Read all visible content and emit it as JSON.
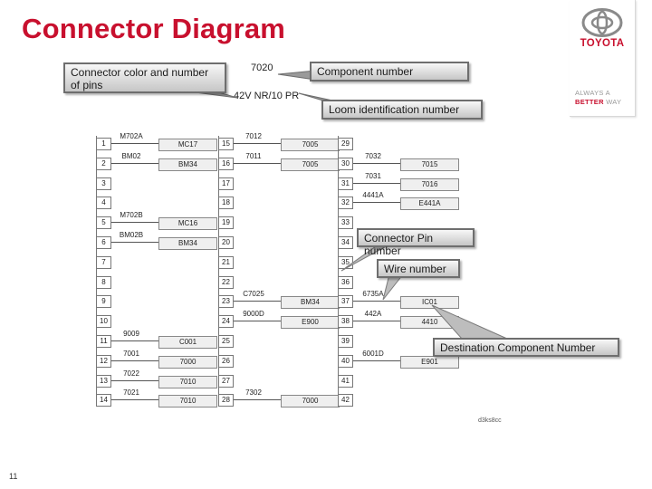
{
  "title": "Connector Diagram",
  "brand": {
    "name": "TOYOTA",
    "tagline_line1": "ALWAYS A",
    "tagline_better": "BETTER",
    "tagline_way": " WAY",
    "color": "#c8102e"
  },
  "connector": {
    "component_number": "7020",
    "loom_id": "42V NR/10 PR"
  },
  "callouts": {
    "connector_color": "Connector color and number of pins",
    "component_number": "Component number",
    "loom_identification": "Loom identification number",
    "connector_pin": "Connector Pin number",
    "wire_number": "Wire number",
    "destination_component": "Destination Component Number"
  },
  "columns": [
    {
      "pins": [
        {
          "pin": "1",
          "wire": "M702A",
          "dest": "MC17"
        },
        {
          "pin": "2",
          "wire": "BM02",
          "dest": "BM34"
        },
        {
          "pin": "3",
          "wire": "",
          "dest": ""
        },
        {
          "pin": "4",
          "wire": "",
          "dest": ""
        },
        {
          "pin": "5",
          "wire": "M702B",
          "dest": "MC16"
        },
        {
          "pin": "6",
          "wire": "BM02B",
          "dest": "BM34"
        },
        {
          "pin": "7",
          "wire": "",
          "dest": ""
        },
        {
          "pin": "8",
          "wire": "",
          "dest": ""
        },
        {
          "pin": "9",
          "wire": "",
          "dest": ""
        },
        {
          "pin": "10",
          "wire": "",
          "dest": ""
        },
        {
          "pin": "11",
          "wire": "9009",
          "dest": "C001"
        },
        {
          "pin": "12",
          "wire": "7001",
          "dest": "7000"
        },
        {
          "pin": "13",
          "wire": "7022",
          "dest": "7010"
        },
        {
          "pin": "14",
          "wire": "7021",
          "dest": "7010"
        }
      ]
    },
    {
      "pins": [
        {
          "pin": "15",
          "wire": "7012",
          "dest": "7005"
        },
        {
          "pin": "16",
          "wire": "7011",
          "dest": "7005"
        },
        {
          "pin": "17",
          "wire": "",
          "dest": ""
        },
        {
          "pin": "18",
          "wire": "",
          "dest": ""
        },
        {
          "pin": "19",
          "wire": "",
          "dest": ""
        },
        {
          "pin": "20",
          "wire": "",
          "dest": ""
        },
        {
          "pin": "21",
          "wire": "",
          "dest": ""
        },
        {
          "pin": "22",
          "wire": "",
          "dest": ""
        },
        {
          "pin": "23",
          "wire": "C7025",
          "dest": "BM34"
        },
        {
          "pin": "24",
          "wire": "9000D",
          "dest": "E900"
        },
        {
          "pin": "25",
          "wire": "",
          "dest": ""
        },
        {
          "pin": "26",
          "wire": "",
          "dest": ""
        },
        {
          "pin": "27",
          "wire": "",
          "dest": ""
        },
        {
          "pin": "28",
          "wire": "7302",
          "dest": "7000"
        }
      ]
    },
    {
      "pins": [
        {
          "pin": "29",
          "wire": "",
          "dest": ""
        },
        {
          "pin": "30",
          "wire": "7032",
          "dest": "7015"
        },
        {
          "pin": "31",
          "wire": "7031",
          "dest": "7016"
        },
        {
          "pin": "32",
          "wire": "4441A",
          "dest": "E441A"
        },
        {
          "pin": "33",
          "wire": "",
          "dest": ""
        },
        {
          "pin": "34",
          "wire": "",
          "dest": ""
        },
        {
          "pin": "35",
          "wire": "",
          "dest": ""
        },
        {
          "pin": "36",
          "wire": "",
          "dest": ""
        },
        {
          "pin": "37",
          "wire": "6735A",
          "dest": "IC01"
        },
        {
          "pin": "38",
          "wire": "442A",
          "dest": "4410"
        },
        {
          "pin": "39",
          "wire": "",
          "dest": ""
        },
        {
          "pin": "40",
          "wire": "6001D",
          "dest": "E901"
        },
        {
          "pin": "41",
          "wire": "",
          "dest": ""
        },
        {
          "pin": "42",
          "wire": "",
          "dest": ""
        }
      ]
    }
  ],
  "figure_code": "d3ks8cc",
  "page_number": "11"
}
